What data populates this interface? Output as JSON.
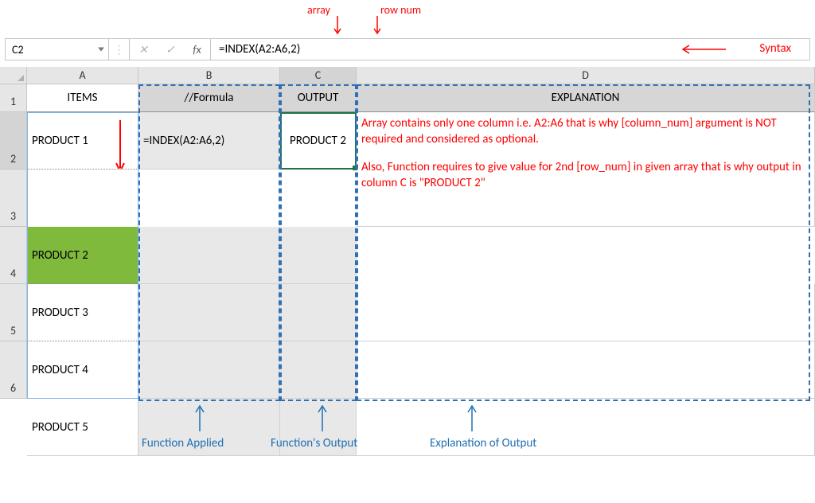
{
  "annotations": {
    "array_label": "array",
    "rownum_label": "row num",
    "syntax_label": "Syntax"
  },
  "formula_bar": {
    "cell_ref": "C2",
    "fx_label": "fx",
    "formula": "=INDEX(A2:A6,2)"
  },
  "columns": {
    "a": "A",
    "b": "B",
    "c": "C",
    "d": "D"
  },
  "rows": {
    "r1": "1",
    "r2": "2",
    "r3": "3",
    "r4": "4",
    "r5": "5",
    "r6": "6"
  },
  "headers": {
    "items": "ITEMS",
    "formula": "//Formula",
    "output": "OUTPUT",
    "explanation": "EXPLANATION"
  },
  "data": {
    "a2": "PRODUCT 1",
    "a3": "PRODUCT 2",
    "a4": "PRODUCT 3",
    "a5": "PRODUCT 4",
    "a6": "PRODUCT 5",
    "b2": "=INDEX(A2:A6,2)",
    "c2": "PRODUCT 2",
    "d_text1": "Array contains only one column i.e. A2:A6 that is why [column_num] argument is NOT required and considered as optional.",
    "d_text2": "Also, Function requires to give value for 2nd [row_num] in given array that is why output in column C is \"PRODUCT 2\""
  },
  "bottom_labels": {
    "func_applied": "Function Applied",
    "func_output": "Function's Output",
    "expl_output": "Explanation of Output"
  },
  "chart_data": {
    "type": "table",
    "title": "Excel INDEX function example",
    "columns": [
      "ITEMS",
      "//Formula",
      "OUTPUT",
      "EXPLANATION"
    ],
    "rows": [
      [
        "PRODUCT 1",
        "=INDEX(A2:A6,2)",
        "PRODUCT 2",
        "Array contains only one column i.e. A2:A6 that is why [column_num] argument is NOT required and considered as optional. Also, Function requires to give value for 2nd [row_num] in given array that is why output in column C is \"PRODUCT 2\""
      ],
      [
        "PRODUCT 2",
        "",
        "",
        ""
      ],
      [
        "PRODUCT 3",
        "",
        "",
        ""
      ],
      [
        "PRODUCT 4",
        "",
        "",
        ""
      ],
      [
        "PRODUCT 5",
        "",
        "",
        ""
      ]
    ],
    "formula_syntax": "=INDEX(A2:A6,2)",
    "syntax_parts": {
      "array": "A2:A6",
      "row_num": 2
    }
  }
}
